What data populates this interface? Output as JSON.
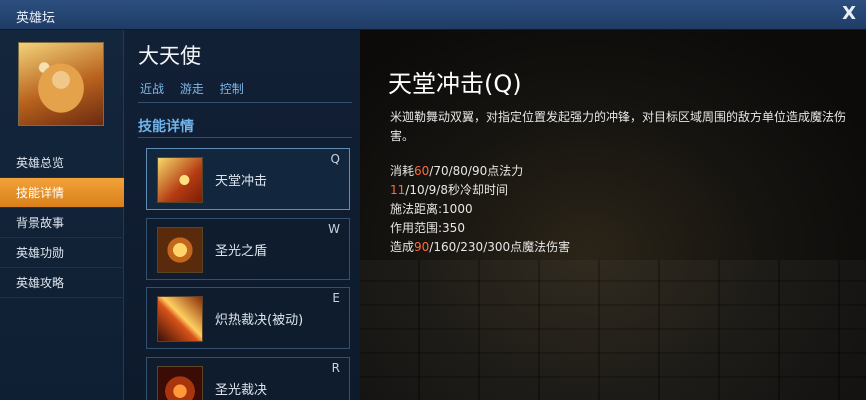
{
  "window": {
    "title": "英雄坛",
    "close_label": "X"
  },
  "sidebar": {
    "nav": [
      {
        "label": "英雄总览",
        "active": false
      },
      {
        "label": "技能详情",
        "active": true
      },
      {
        "label": "背景故事",
        "active": false
      },
      {
        "label": "英雄功勋",
        "active": false
      },
      {
        "label": "英雄攻略",
        "active": false
      }
    ]
  },
  "hero": {
    "name": "大天使",
    "tags": [
      "近战",
      "游走",
      "控制"
    ],
    "section_title": "技能详情"
  },
  "skills": [
    {
      "name": "天堂冲击",
      "key": "Q",
      "icon": "heaven-strike-icon",
      "active": true
    },
    {
      "name": "圣光之盾",
      "key": "W",
      "icon": "holy-shield-icon",
      "active": false
    },
    {
      "name": "炽热裁决(被动)",
      "key": "E",
      "icon": "blazing-judgment-icon",
      "active": false
    },
    {
      "name": "圣光裁决",
      "key": "R",
      "icon": "holy-judgment-icon",
      "active": false
    }
  ],
  "detail": {
    "title": "天堂冲击(Q)",
    "description": "米迦勒舞动双翼，对指定位置发起强力的冲锋，对目标区域周围的敌方单位造成魔法伤害。",
    "cost": {
      "prefix": "消耗",
      "highlight": "60",
      "rest": "/70/80/90点法力"
    },
    "cooldown": {
      "highlight": "11",
      "rest": "/10/9/8秒冷却时间"
    },
    "range": "施法距离:1000",
    "area": "作用范围:350",
    "damage": {
      "prefix": "造成",
      "highlight": "90",
      "rest": "/160/230/300点魔法伤害"
    }
  },
  "colors": {
    "accent": "#f2a23a",
    "highlight": "#ff6a3d",
    "link": "#7fb6e8"
  }
}
